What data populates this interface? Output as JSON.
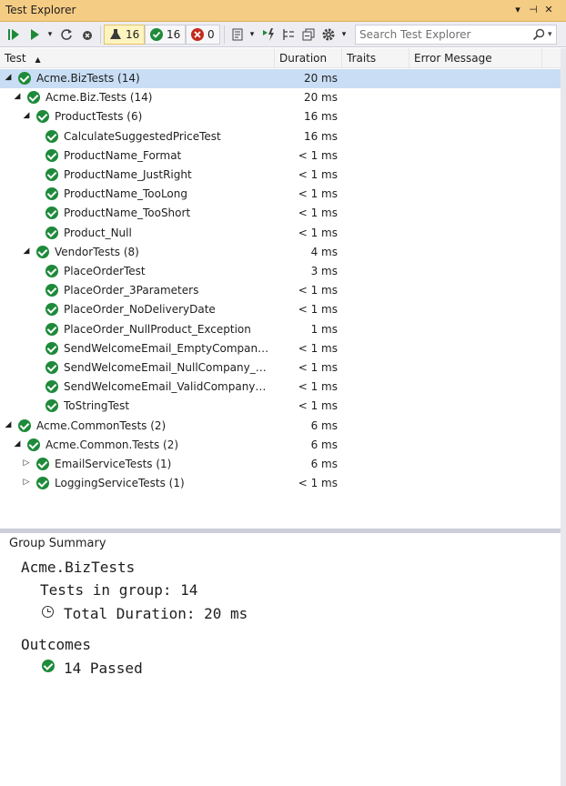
{
  "window": {
    "title": "Test Explorer",
    "dropdown_glyph": "▾",
    "pin_glyph": "⊣",
    "close_glyph": "✕"
  },
  "toolbar": {
    "total_count": "16",
    "passed_count": "16",
    "failed_count": "0",
    "search_placeholder": "Search Test Explorer"
  },
  "columns": {
    "test": "Test",
    "duration": "Duration",
    "traits": "Traits",
    "error": "Error Message"
  },
  "tree": [
    {
      "name": "Acme.BizTests (14)",
      "duration": "20 ms",
      "level": 0,
      "expanded": true,
      "selected": true
    },
    {
      "name": "Acme.Biz.Tests (14)",
      "duration": "20 ms",
      "level": 1,
      "expanded": true
    },
    {
      "name": "ProductTests (6)",
      "duration": "16 ms",
      "level": 2,
      "expanded": true
    },
    {
      "name": "CalculateSuggestedPriceTest",
      "duration": "16 ms",
      "level": 3
    },
    {
      "name": "ProductName_Format",
      "duration": "< 1 ms",
      "level": 3
    },
    {
      "name": "ProductName_JustRight",
      "duration": "< 1 ms",
      "level": 3
    },
    {
      "name": "ProductName_TooLong",
      "duration": "< 1 ms",
      "level": 3
    },
    {
      "name": "ProductName_TooShort",
      "duration": "< 1 ms",
      "level": 3
    },
    {
      "name": "Product_Null",
      "duration": "< 1 ms",
      "level": 3
    },
    {
      "name": "VendorTests (8)",
      "duration": "4 ms",
      "level": 2,
      "expanded": true
    },
    {
      "name": "PlaceOrderTest",
      "duration": "3 ms",
      "level": 3
    },
    {
      "name": "PlaceOrder_3Parameters",
      "duration": "< 1 ms",
      "level": 3
    },
    {
      "name": "PlaceOrder_NoDeliveryDate",
      "duration": "< 1 ms",
      "level": 3
    },
    {
      "name": "PlaceOrder_NullProduct_Exception",
      "duration": "1 ms",
      "level": 3
    },
    {
      "name": "SendWelcomeEmail_EmptyCompany_...",
      "duration": "< 1 ms",
      "level": 3
    },
    {
      "name": "SendWelcomeEmail_NullCompany_S...",
      "duration": "< 1 ms",
      "level": 3
    },
    {
      "name": "SendWelcomeEmail_ValidCompany_S...",
      "duration": "< 1 ms",
      "level": 3
    },
    {
      "name": "ToStringTest",
      "duration": "< 1 ms",
      "level": 3
    },
    {
      "name": "Acme.CommonTests (2)",
      "duration": "6 ms",
      "level": 0,
      "expanded": true
    },
    {
      "name": "Acme.Common.Tests (2)",
      "duration": "6 ms",
      "level": 1,
      "expanded": true
    },
    {
      "name": "EmailServiceTests (1)",
      "duration": "6 ms",
      "level": 2,
      "expanded": false
    },
    {
      "name": "LoggingServiceTests (1)",
      "duration": "< 1 ms",
      "level": 2,
      "expanded": false
    }
  ],
  "summary": {
    "heading": "Group Summary",
    "group_name": "Acme.BizTests",
    "tests_in_group": "Tests in group: 14",
    "total_duration": "Total Duration: 20 ms",
    "outcomes_heading": "Outcomes",
    "passed": "14 Passed"
  },
  "colors": {
    "title_bar": "#f5cc84",
    "passed": "#1e8a3a",
    "failed": "#c42b1c",
    "selection": "#c9def5"
  }
}
